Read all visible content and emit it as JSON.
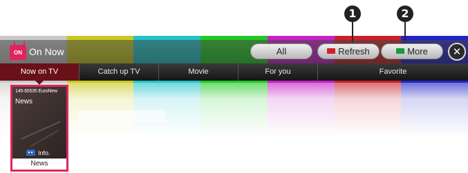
{
  "colors": {
    "bars": [
      "#c8c8c8",
      "#c8c821",
      "#22c3c8",
      "#22c825",
      "#c422c4",
      "#c8212a",
      "#2224c4"
    ],
    "accent": "#e0245e",
    "active_tab": "#6a1018"
  },
  "callouts": [
    "1",
    "2"
  ],
  "app": {
    "logo_text": "ON NOW",
    "title": "On Now"
  },
  "buttons": {
    "all": "All",
    "refresh": "Refresh",
    "more": "More",
    "close": "✕"
  },
  "tabs": [
    {
      "label": "Now on TV",
      "active": true
    },
    {
      "label": "Catch up TV",
      "active": false
    },
    {
      "label": "Movie",
      "active": false
    },
    {
      "label": "For you",
      "active": false
    },
    {
      "label": "Favorite",
      "active": false
    }
  ],
  "card": {
    "channel": "145-65535 EuroNew",
    "title": "News",
    "info_label": "Info.",
    "footer": "News"
  }
}
